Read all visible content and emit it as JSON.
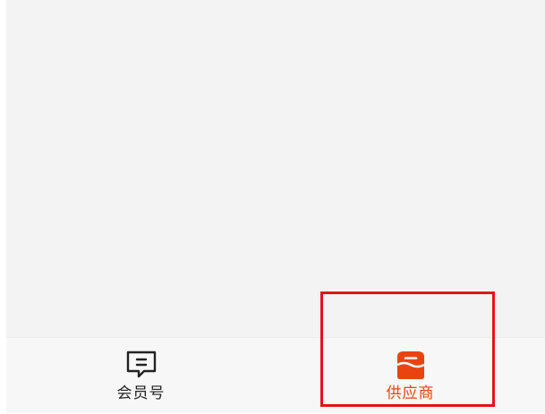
{
  "tab_bar": {
    "tabs": [
      {
        "label": "会员号",
        "icon": "chat-message-icon",
        "active": false
      },
      {
        "label": "供应商",
        "icon": "store-icon",
        "active": true
      }
    ]
  },
  "colors": {
    "active": "#e9440f",
    "inactive": "#222222",
    "highlight_box": "#e3141b",
    "background": "#f3f3f3"
  }
}
